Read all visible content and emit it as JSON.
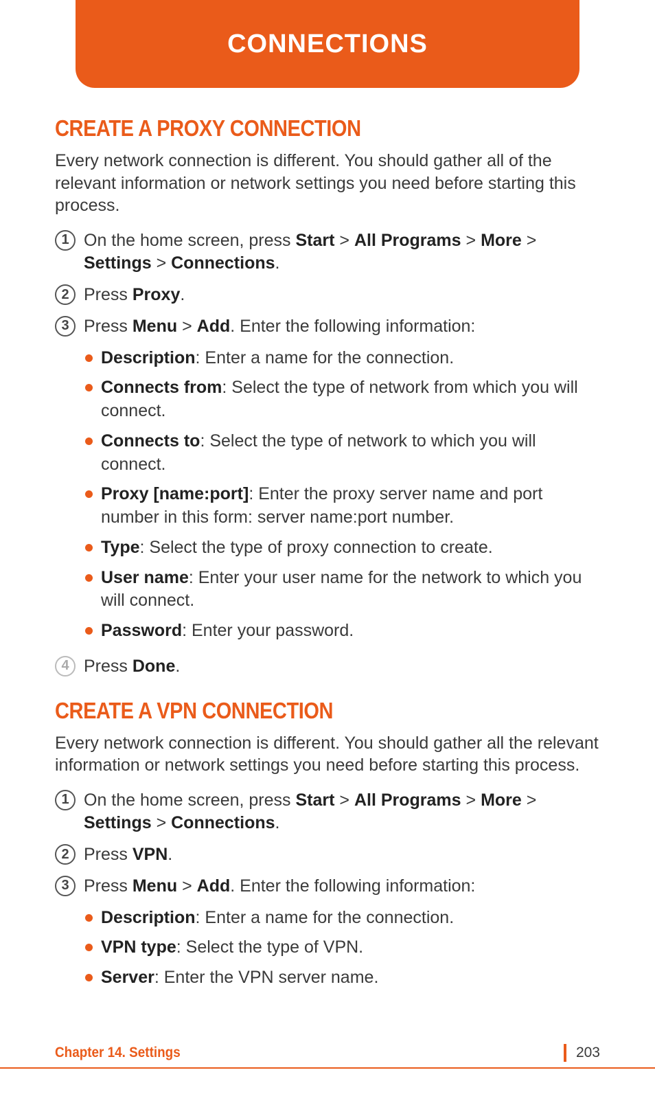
{
  "header": {
    "title": "CONNECTIONS"
  },
  "section1": {
    "title": "CREATE A PROXY CONNECTION",
    "intro": "Every network connection is different. You should gather all of the relevant information or network settings you need before starting this process.",
    "steps": {
      "s1_pre": "On the home screen, press ",
      "s1_b1": "Start",
      "s1_gt1": " > ",
      "s1_b2": "All Programs",
      "s1_gt2": " > ",
      "s1_b3": "More",
      "s1_gt3": " > ",
      "s1_b4": "Settings",
      "s1_gt4": " > ",
      "s1_b5": "Connections",
      "s1_post": ".",
      "s2_pre": "Press ",
      "s2_b1": "Proxy",
      "s2_post": ".",
      "s3_pre": "Press ",
      "s3_b1": "Menu",
      "s3_gt1": " > ",
      "s3_b2": "Add",
      "s3_post": ". Enter the following information:",
      "s4_pre": "Press ",
      "s4_b1": "Done",
      "s4_post": "."
    },
    "bullets": {
      "b1_label": "Description",
      "b1_text": ": Enter a name for the connection.",
      "b2_label": "Connects from",
      "b2_text": ": Select the type of network from which you will connect.",
      "b3_label": "Connects to",
      "b3_text": ": Select the type of network to which you will connect.",
      "b4_label": "Proxy [name:port]",
      "b4_text": ": Enter the proxy server name and port number in this form: server name:port number.",
      "b5_label": "Type",
      "b5_text": ": Select the type of proxy connection to create.",
      "b6_label": "User name",
      "b6_text": ": Enter your user name for the network to which you will connect.",
      "b7_label": "Password",
      "b7_text": ": Enter your password."
    }
  },
  "section2": {
    "title": "CREATE A VPN CONNECTION",
    "intro": "Every network connection is different. You should gather all the relevant information or network settings you need before starting this process.",
    "steps": {
      "s1_pre": "On the home screen, press ",
      "s1_b1": "Start",
      "s1_gt1": " > ",
      "s1_b2": "All Programs",
      "s1_gt2": " > ",
      "s1_b3": "More",
      "s1_gt3": " > ",
      "s1_b4": "Settings",
      "s1_gt4": " > ",
      "s1_b5": "Connections",
      "s1_post": ".",
      "s2_pre": "Press ",
      "s2_b1": "VPN",
      "s2_post": ".",
      "s3_pre": "Press ",
      "s3_b1": "Menu",
      "s3_gt1": " > ",
      "s3_b2": "Add",
      "s3_post": ". Enter the following information:"
    },
    "bullets": {
      "b1_label": "Description",
      "b1_text": ": Enter a name for the connection.",
      "b2_label": "VPN type",
      "b2_text": ": Select the type of VPN.",
      "b3_label": "Server",
      "b3_text": ": Enter the VPN server name."
    }
  },
  "footer": {
    "chapter": "Chapter 14. Settings",
    "page": "203"
  },
  "nums": {
    "n1": "1",
    "n2": "2",
    "n3": "3",
    "n4": "4"
  }
}
